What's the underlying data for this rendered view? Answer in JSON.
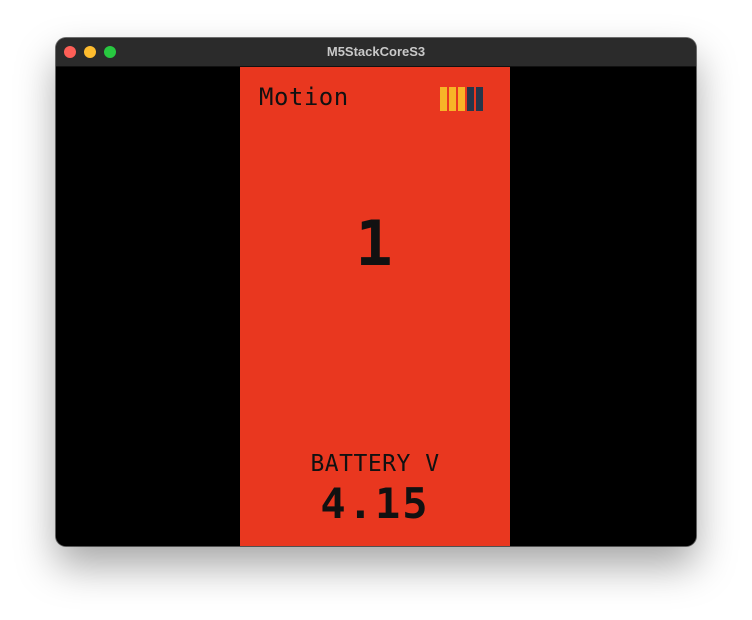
{
  "window": {
    "title": "M5StackCoreS3"
  },
  "screen": {
    "mode_label": "Motion",
    "counter_value": "1",
    "battery_label": "BATTERY V",
    "battery_value": "4.15",
    "level_indicator": {
      "segments_total": 5,
      "segments_filled": 3,
      "filled_color": "#f7b427",
      "empty_color": "#27364a"
    },
    "background_color": "#e9371f"
  }
}
